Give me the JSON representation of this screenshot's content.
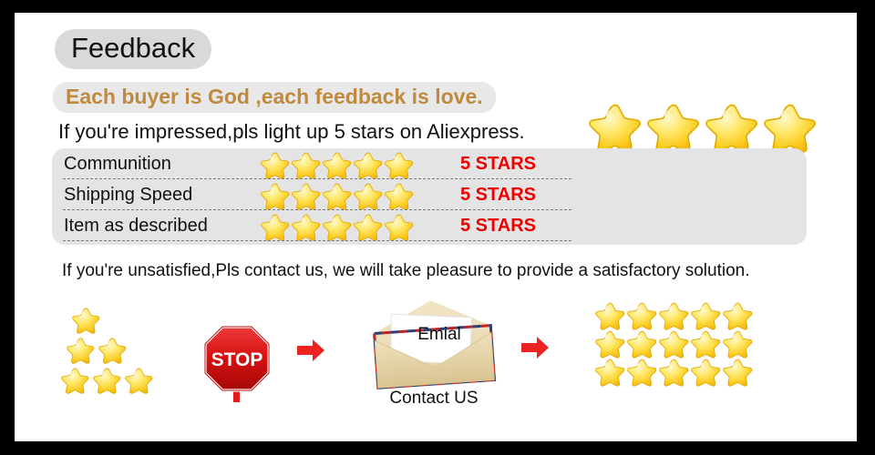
{
  "page": {
    "title_pill": "Feedback",
    "tagline": "Each buyer is God ,each feedback is love.",
    "impressed_line": "If you're impressed,pls light up 5 stars on Aliexpress.",
    "unsatisfied_line": "If you're unsatisfied,Pls contact us, we will take pleasure to provide a satisfactory solution."
  },
  "colors": {
    "frame": "#000000",
    "canvas": "#ffffff",
    "pill_bg": "#d9d9d9",
    "tagline_bg": "#e8e8e8",
    "tagline_text": "#c08a3e",
    "panel_bg": "#e4e4e4",
    "stars_value_red": "#ee0000",
    "star_gold": "#f5c518",
    "arrow_red": "#ef2222",
    "stop_red": "#cc0000"
  },
  "top_stars": {
    "count": 4,
    "size": 62,
    "icon": "star-icon"
  },
  "ratings_panel": {
    "rows": [
      {
        "label": "Communition",
        "stars": 5,
        "value": "5 STARS"
      },
      {
        "label": "Shipping Speed",
        "stars": 5,
        "value": "5 STARS"
      },
      {
        "label": "Item as described",
        "stars": 5,
        "value": "5 STARS"
      }
    ]
  },
  "flow": {
    "staircase_stars": {
      "icon": "star-icon",
      "rows": [
        1,
        2,
        3
      ],
      "size": 33
    },
    "stop_sign": {
      "icon": "stop-sign-icon",
      "label": "STOP"
    },
    "arrow_1": {
      "icon": "arrow-right-icon"
    },
    "arrow_2": {
      "icon": "arrow-right-icon"
    },
    "envelope": {
      "icon": "envelope-icon",
      "inner_text": "Emial",
      "caption": "Contact US"
    },
    "star_grid": {
      "icon": "star-icon",
      "columns": 5,
      "rows": 3,
      "total": 15,
      "size": 35
    }
  }
}
